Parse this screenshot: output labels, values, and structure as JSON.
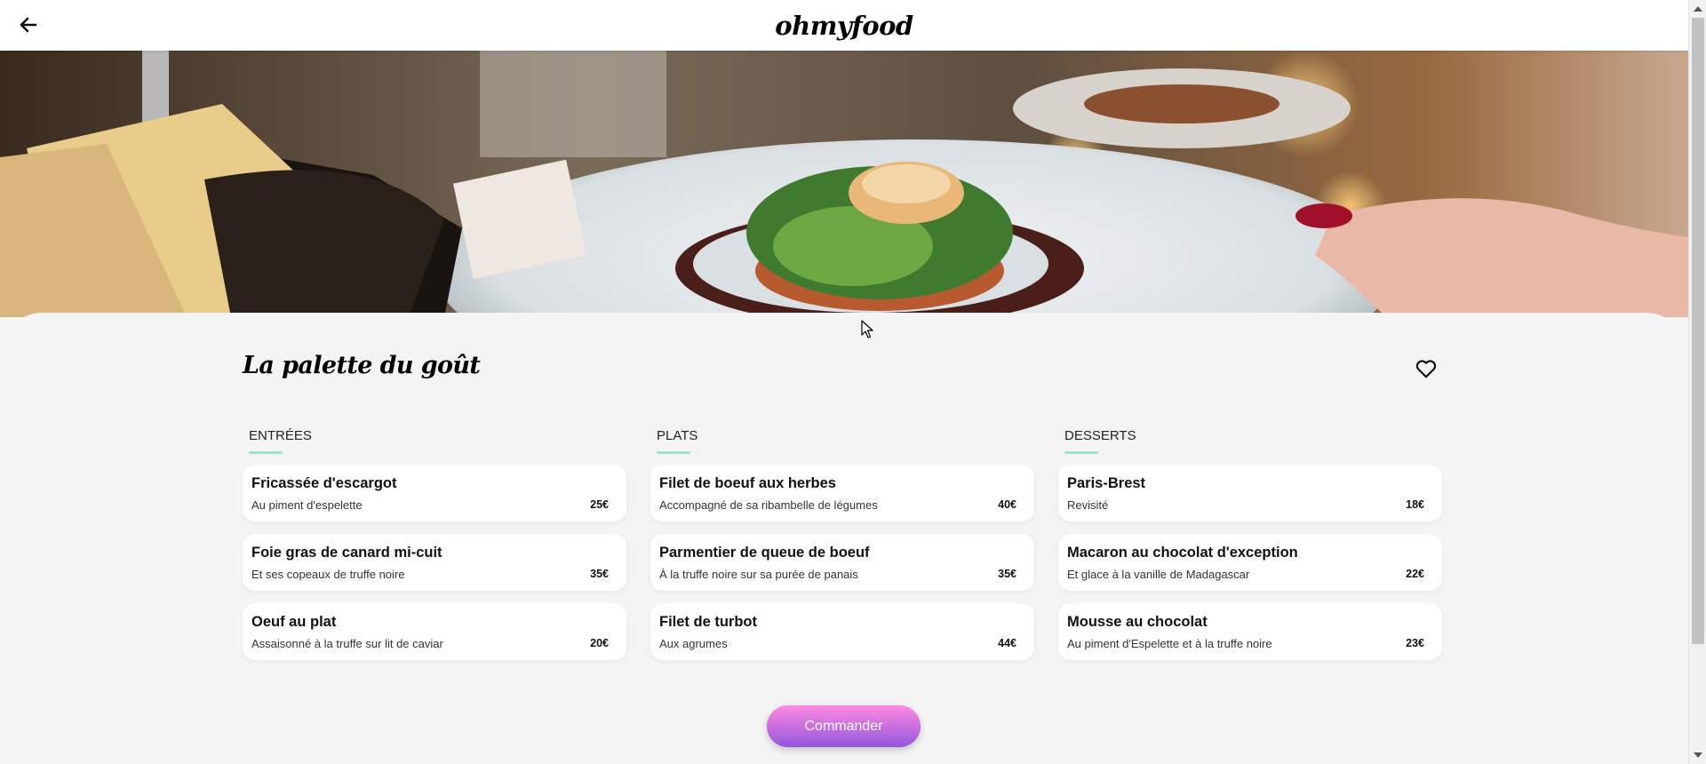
{
  "header": {
    "logo": "ohmyfood",
    "back_icon": "arrow-left-icon"
  },
  "hero": {
    "description_icon": "food-photo"
  },
  "restaurant": {
    "name": "La palette du goût",
    "favorite_icon": "heart-outline-icon"
  },
  "menu": [
    {
      "heading": "ENTRÉES",
      "items": [
        {
          "name": "Fricassée d'escargot",
          "desc": "Au piment d'espelette",
          "price": "25€"
        },
        {
          "name": "Foie gras de canard mi-cuit",
          "desc": "Et ses copeaux de truffe noire",
          "price": "35€"
        },
        {
          "name": "Oeuf au plat",
          "desc": "Assaisonné à la truffe sur lit de caviar",
          "price": "20€"
        }
      ]
    },
    {
      "heading": "PLATS",
      "items": [
        {
          "name": "Filet de boeuf aux herbes",
          "desc": "Accompagné de sa ribambelle de légumes",
          "price": "40€"
        },
        {
          "name": "Parmentier de queue de boeuf",
          "desc": "À la truffe noire sur sa purée de panais",
          "price": "35€"
        },
        {
          "name": "Filet de turbot",
          "desc": "Aux agrumes",
          "price": "44€"
        }
      ]
    },
    {
      "heading": "DESSERTS",
      "items": [
        {
          "name": "Paris-Brest",
          "desc": "Revisité",
          "price": "18€"
        },
        {
          "name": "Macaron au chocolat d'exception",
          "desc": "Et glace à la vanille de Madagascar",
          "price": "22€"
        },
        {
          "name": "Mousse au chocolat",
          "desc": "Au piment d'Espelette et à la truffe noire",
          "price": "23€"
        }
      ]
    }
  ],
  "order_button": "Commander",
  "colors": {
    "accent_underline": "#99e2d0",
    "button_top": "#ff8ae2",
    "button_bottom": "#9356dc",
    "background": "#f4f4f4"
  }
}
